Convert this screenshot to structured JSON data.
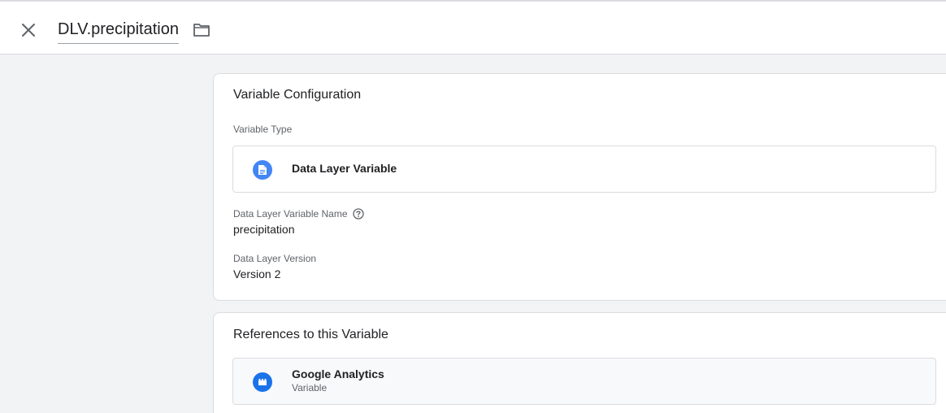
{
  "header": {
    "title": "DLV.precipitation",
    "close_icon": "close-icon",
    "folder_icon": "folder-icon"
  },
  "config": {
    "title": "Variable Configuration",
    "variable_type_label": "Variable Type",
    "variable_type": {
      "name": "Data Layer Variable",
      "icon": "document-icon",
      "icon_color": "#4285f4"
    },
    "dlv_name_label": "Data Layer Variable Name",
    "dlv_name_value": "precipitation",
    "version_label": "Data Layer Version",
    "version_value": "Version 2"
  },
  "references": {
    "title": "References to this Variable",
    "items": [
      {
        "name": "Google Analytics",
        "subtitle": "Variable",
        "icon": "building-blocks-icon",
        "icon_color": "#1a73e8"
      }
    ]
  },
  "colors": {
    "background": "#f1f3f4",
    "accent": "#4285f4"
  }
}
